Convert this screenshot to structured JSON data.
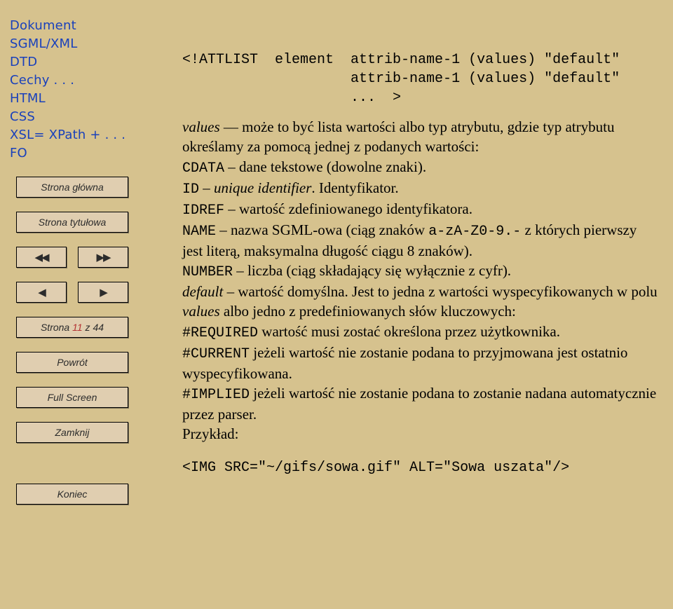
{
  "nav": {
    "dokument": "Dokument",
    "sgmlxml": "SGML/XML",
    "dtd": "DTD",
    "cechy": "Cechy . . .",
    "html": "HTML",
    "css": "CSS",
    "xsl": "XSL= XPath + . . .",
    "fo": "FO"
  },
  "buttons": {
    "home": "Strona główna",
    "title": "Strona tytułowa",
    "back": "Powrót",
    "fullscreen": "Full Screen",
    "close": "Zamknij",
    "end": "Koniec",
    "page_prefix": "Strona ",
    "page_current": "11",
    "page_sep": " z ",
    "page_total": "44"
  },
  "code": {
    "line1": "<!ATTLIST  element  attrib-name-1 (values) \"default\"",
    "line2": "                    attrib-name-1 (values) \"default\"",
    "line3": "                    ...  >"
  },
  "body": {
    "t1a": "values",
    "t1b": " — może to być lista wartości albo typ atrybutu, gdzie typ atrybutu określamy za pomocą jednej z podanych wartości:",
    "t2a": "CDATA",
    "t2b": " – dane tekstowe (dowolne znaki).",
    "t3a": "ID",
    "t3b": " – ",
    "t3c": "unique identifier",
    "t3d": ". Identyfikator.",
    "t4a": "IDREF",
    "t4b": " – wartość zdefiniowanego identyfikatora.",
    "t5a": "NAME",
    "t5b": " – nazwa SGML-owa (ciąg znaków ",
    "t5c": "a-zA-Z0-9.-",
    "t5d": " z których pierwszy jest literą, maksymalna długość ciągu 8 znaków).",
    "t6a": "NUMBER",
    "t6b": " – liczba (ciąg składający się wyłącznie z cyfr).",
    "t7a": "default",
    "t7b": " – wartość domyślna. Jest to jedna z wartości wyspecyfikowanych w polu ",
    "t7c": "values",
    "t7d": " albo jedno z predefiniowanych słów kluczowych:",
    "t8a": "#REQUIRED",
    "t8b": " wartość musi zostać określona przez użytkownika.",
    "t9a": "#CURRENT",
    "t9b": " jeżeli wartość nie zostanie podana to przyjmowana jest ostatnio wyspecyfikowana.",
    "t10a": "#IMPLIED",
    "t10b": " jeżeli wartość nie zostanie podana to zostanie nadana automatycznie przez parser.",
    "t11": "Przykład:",
    "example": "<IMG SRC=\"~/gifs/sowa.gif\" ALT=\"Sowa uszata\"/>"
  }
}
